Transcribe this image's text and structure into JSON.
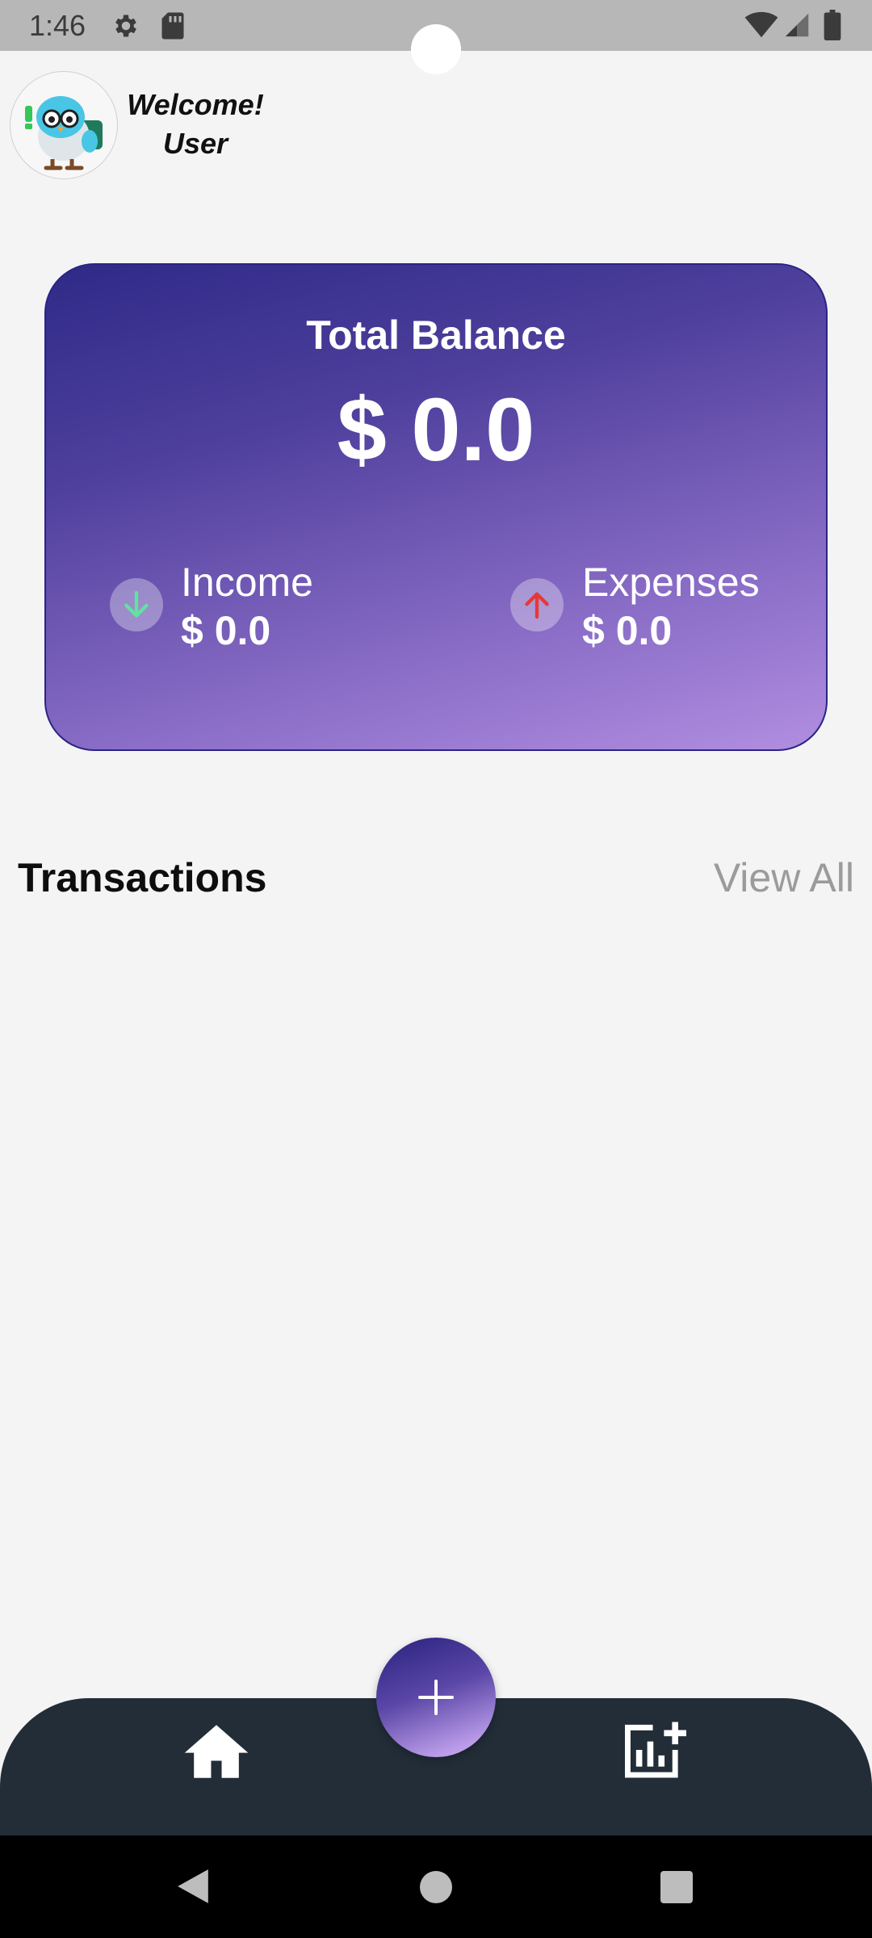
{
  "status_bar": {
    "time": "1:46",
    "icons": [
      "gear-icon",
      "sd-card-icon",
      "wifi-icon",
      "signal-icon",
      "battery-icon"
    ]
  },
  "header": {
    "welcome": "Welcome!",
    "user": "User",
    "avatar": "bird-mascot-avatar"
  },
  "balance_card": {
    "title": "Total Balance",
    "amount": "$ 0.0",
    "income": {
      "label": "Income",
      "amount": "$ 0.0",
      "icon": "arrow-down-icon",
      "color": "#5fe3a1"
    },
    "expenses": {
      "label": "Expenses",
      "amount": "$ 0.0",
      "icon": "arrow-up-icon",
      "color": "#e53935"
    },
    "gradient_colors": [
      "#2f2a87",
      "#b18ee0"
    ]
  },
  "transactions": {
    "title": "Transactions",
    "view_all": "View All",
    "items": []
  },
  "bottom_nav": {
    "items": [
      "home-icon",
      "add-chart-icon"
    ],
    "fab": "plus-icon",
    "background": "#222d38"
  },
  "system_nav": {
    "buttons": [
      "back-icon",
      "home-circle-icon",
      "recents-square-icon"
    ]
  }
}
